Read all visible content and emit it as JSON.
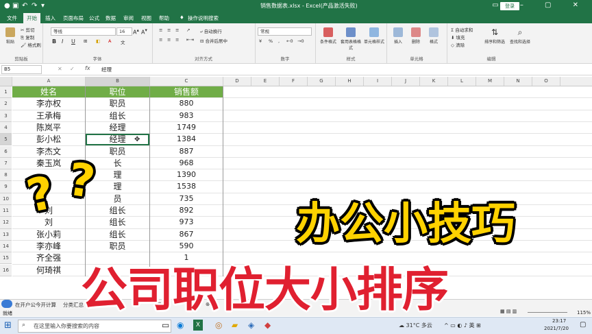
{
  "titlebar": {
    "doc_title": "销售数据表.xlsx - Excel(产品激活失败)",
    "login_label": "登录",
    "qa_icons": [
      "save-icon",
      "undo-icon",
      "redo-icon"
    ]
  },
  "tabs": [
    "文件",
    "开始",
    "插入",
    "页面布局",
    "公式",
    "数据",
    "审阅",
    "视图",
    "帮助",
    "操作说明搜索"
  ],
  "active_tab": 1,
  "ribbon": {
    "clipboard": {
      "label": "剪贴板",
      "paste": "粘贴",
      "cut": "剪切",
      "copy": "复制",
      "format_painter": "格式刷"
    },
    "font": {
      "label": "字体",
      "font_name": "等线",
      "font_size": "16",
      "bold": "B",
      "italic": "I",
      "underline": "U"
    },
    "alignment": {
      "label": "对齐方式",
      "wrap": "自动换行",
      "merge": "合并后居中"
    },
    "number": {
      "label": "数字",
      "format": "常规",
      "percent": "%"
    },
    "styles": {
      "label": "样式",
      "conditional": "条件格式",
      "table": "套用表格格式",
      "cell": "单元格样式"
    },
    "cells": {
      "label": "单元格",
      "insert": "插入",
      "delete": "删除",
      "format": "格式"
    },
    "editing": {
      "label": "编辑",
      "autosum": "自动求和",
      "fill": "填充",
      "clear": "清除",
      "sort": "排序和筛选",
      "find": "查找和选择"
    }
  },
  "formula_bar": {
    "name_box": "B5",
    "fx": "fx",
    "value": "经理"
  },
  "columns": [
    "A",
    "B",
    "C",
    "D",
    "E",
    "F",
    "G",
    "H",
    "I",
    "J",
    "K",
    "L",
    "M",
    "N",
    "O"
  ],
  "rows": [
    "1",
    "2",
    "3",
    "4",
    "5",
    "6",
    "7",
    "8",
    "9",
    "10",
    "11",
    "12",
    "13",
    "14",
    "15",
    "16"
  ],
  "table": {
    "headers": [
      "姓名",
      "职位",
      "销售额"
    ],
    "data": [
      [
        "李亦权",
        "职员",
        "880"
      ],
      [
        "王承梅",
        "组长",
        "983"
      ],
      [
        "陈岚平",
        "经理",
        "1749"
      ],
      [
        "彭小松",
        "经理",
        "1384"
      ],
      [
        "李杰文",
        "职员",
        "887"
      ],
      [
        "秦玉岚",
        "长",
        "968"
      ],
      [
        "",
        "理",
        "1390"
      ],
      [
        "",
        "理",
        "1538"
      ],
      [
        "",
        "员",
        "735"
      ],
      [
        "刘",
        "组长",
        "892"
      ],
      [
        "刘",
        "组长",
        "973"
      ],
      [
        "张小莉",
        "组长",
        "867"
      ],
      [
        "李亦峰",
        "职员",
        "590"
      ],
      [
        "齐全强",
        "",
        "1"
      ],
      [
        "何琦祺",
        "",
        ""
      ]
    ]
  },
  "sheet_tabs": [
    "在开户公",
    "今开计算",
    "分类汇总",
    "",
    "",
    "莱函",
    ""
  ],
  "status": {
    "ready": "就绪",
    "zoom": "115%"
  },
  "taskbar": {
    "search_placeholder": "在这里输入你要搜索的内容",
    "weather": "31°C 多云",
    "time": "23:17",
    "date": "2021/7/20"
  },
  "overlay": {
    "title": "办公小技巧",
    "subtitle": "公司职位大小排序",
    "q1": "?",
    "q2": "?"
  },
  "colors": {
    "excel_green": "#217346",
    "header_fill": "#70ad47",
    "title_yellow": "#ffd200",
    "subtitle_red": "#e02030"
  }
}
